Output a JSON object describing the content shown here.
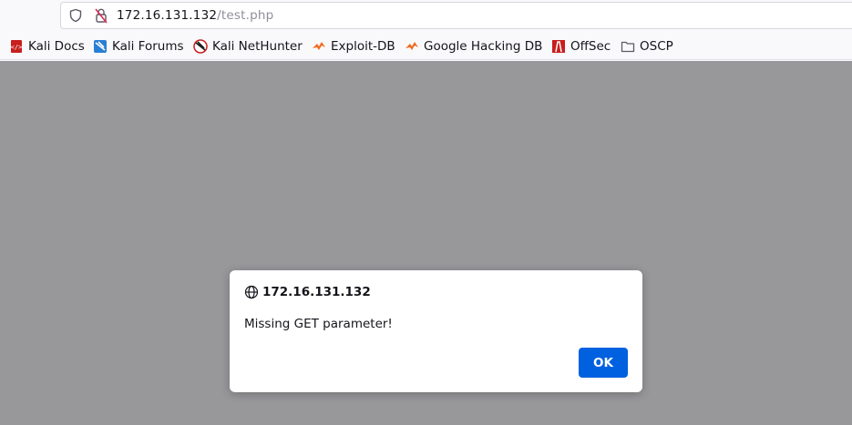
{
  "urlbar": {
    "host": "172.16.131.132",
    "path": "/test.php"
  },
  "bookmarks": [
    {
      "label": "Kali Docs",
      "icon": "kali-docs-icon"
    },
    {
      "label": "Kali Forums",
      "icon": "kali-forums-icon"
    },
    {
      "label": "Kali NetHunter",
      "icon": "kali-nethunter-icon"
    },
    {
      "label": "Exploit-DB",
      "icon": "exploit-db-icon"
    },
    {
      "label": "Google Hacking DB",
      "icon": "ghdb-icon"
    },
    {
      "label": "OffSec",
      "icon": "offsec-icon"
    },
    {
      "label": "OSCP",
      "icon": "folder-icon"
    }
  ],
  "dialog": {
    "title": "172.16.131.132",
    "message": "Missing GET parameter!",
    "ok_label": "OK"
  },
  "colors": {
    "overlay": "#98989b",
    "accent": "#0061e0"
  }
}
